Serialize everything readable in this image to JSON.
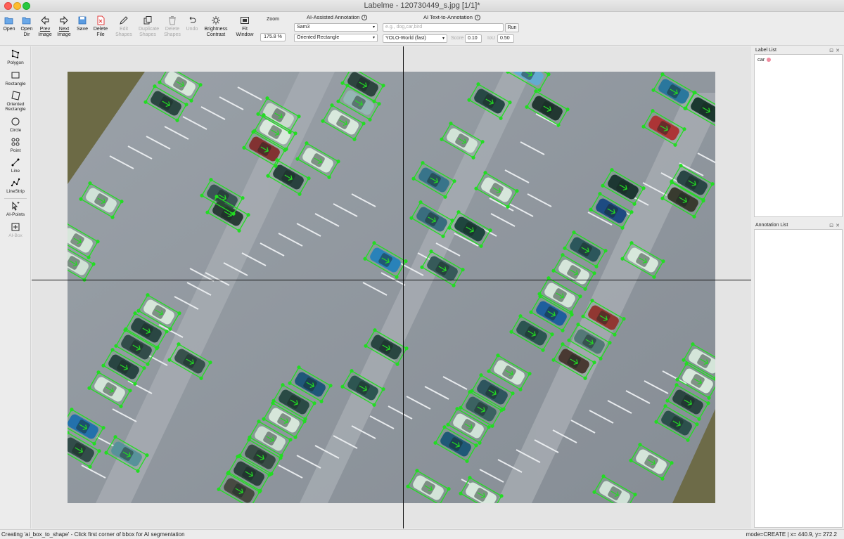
{
  "window": {
    "title": "Labelme - 120730449_s.jpg [1/1]*"
  },
  "toolbar": {
    "open": "Open",
    "open_dir": [
      "Open",
      "Dir"
    ],
    "prev_image": [
      "Prev",
      "Image"
    ],
    "next_image": [
      "Next",
      "Image"
    ],
    "save": "Save",
    "delete_file": [
      "Delete",
      "File"
    ],
    "edit_shapes": [
      "Edit",
      "Shapes"
    ],
    "duplicate_shapes": [
      "Duplicate",
      "Shapes"
    ],
    "delete_shapes": [
      "Delete",
      "Shapes"
    ],
    "undo": "Undo",
    "brightness_contrast": [
      "Brightness",
      "Contrast"
    ],
    "fit_window": [
      "Fit",
      "Window"
    ],
    "zoom_label": "Zoom",
    "zoom_value": "175.8 %"
  },
  "ai_assisted": {
    "title": "AI-Assisted Annotation",
    "model": "Sam3",
    "output": "Oriented Rectangle"
  },
  "ai_text": {
    "title": "AI Text-to-Annotation",
    "prompt_placeholder": "e.g., dog,car,bird",
    "run": "Run",
    "model": "YOLO-World (fast)",
    "score_label": "Score",
    "score_value": "0.10",
    "iou_label": "IoU",
    "iou_value": "0.50"
  },
  "left_tools": {
    "polygon": "Polygon",
    "rectangle": "Rectangle",
    "oriented_rectangle": [
      "Oriented",
      "Rectangle"
    ],
    "circle": "Circle",
    "point": "Point",
    "line": "Line",
    "linestrip": "LineStrip",
    "ai_points": "AI-Points",
    "ai_box": "AI-Box"
  },
  "label_list": {
    "title": "Label List",
    "items": [
      {
        "label": "car",
        "color": "#f08ca0"
      }
    ]
  },
  "annotation_list": {
    "title": "Annotation List"
  },
  "status": {
    "message": "Creating 'ai_box_to_shape' - Click first corner of bbox for AI segmentation",
    "mode": "mode=CREATE  |  x=  440.9,  y=  272.2"
  },
  "colors": {
    "annotation": "#22dd22",
    "accent": "#2f7ad6"
  }
}
